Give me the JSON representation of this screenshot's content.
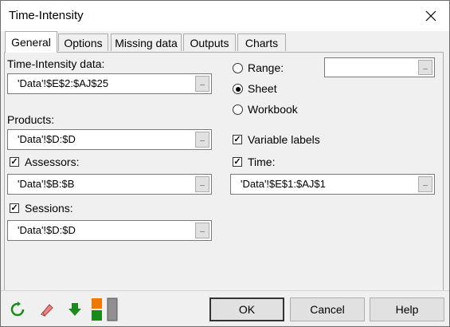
{
  "window": {
    "title": "Time-Intensity"
  },
  "tabs": [
    {
      "label": "General",
      "active": true
    },
    {
      "label": "Options"
    },
    {
      "label": "Missing data"
    },
    {
      "label": "Outputs"
    },
    {
      "label": "Charts"
    }
  ],
  "general": {
    "ti_data_label": "Time-Intensity data:",
    "ti_data_value": "'Data'!$E$2:$AJ$25",
    "products_label": "Products:",
    "products_value": "'Data'!$D:$D",
    "assessors_label": "Assessors:",
    "assessors_checked": true,
    "assessors_value": "'Data'!$B:$B",
    "sessions_label": "Sessions:",
    "sessions_checked": true,
    "sessions_value": "'Data'!$D:$D",
    "range_label": "Range:",
    "range_value": "",
    "sheet_label": "Sheet",
    "workbook_label": "Workbook",
    "selected_output": "Sheet",
    "variable_labels_label": "Variable labels",
    "variable_labels_checked": true,
    "time_label": "Time:",
    "time_checked": true,
    "time_value": "'Data'!$E$1:$AJ$1",
    "picker_glyph": "_",
    "check_glyph": "✓"
  },
  "buttons": {
    "ok": "OK",
    "cancel": "Cancel",
    "help": "Help"
  },
  "toolbar": [
    "reset-icon",
    "eraser-icon",
    "down-arrow-icon",
    "layout-icon"
  ],
  "colors": {
    "accent_green": "#1a8a1a",
    "accent_orange": "#f07800"
  }
}
